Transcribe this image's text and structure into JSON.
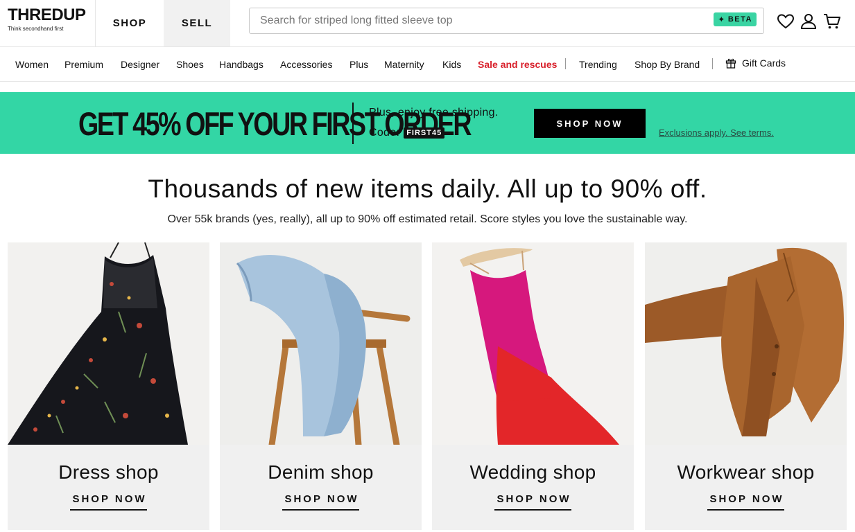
{
  "brand": {
    "name": "THREDUP",
    "tagline": "Think secondhand first"
  },
  "header": {
    "tabs": [
      {
        "label": "SHOP"
      },
      {
        "label": "SELL"
      }
    ],
    "search": {
      "placeholder": "Search for striped long fitted sleeve top",
      "badge": "BETA"
    },
    "icons": [
      "heart-icon",
      "account-icon",
      "cart-icon"
    ]
  },
  "categories": [
    {
      "label": "Women"
    },
    {
      "label": "Premium"
    },
    {
      "label": "Designer"
    },
    {
      "label": "Shoes"
    },
    {
      "label": "Handbags"
    },
    {
      "label": "Accessories"
    },
    {
      "label": "Plus"
    },
    {
      "label": "Maternity"
    },
    {
      "label": "Kids"
    },
    {
      "label": "Sale and rescues"
    },
    {
      "label": "Trending"
    },
    {
      "label": "Shop By Brand"
    },
    {
      "label": "Gift Cards"
    }
  ],
  "promo": {
    "headline": "GET 45% OFF YOUR FIRST ORDER",
    "shipping": "Plus, enjoy free shipping.",
    "code_label": "Code:",
    "code": "FIRST45",
    "button": "SHOP NOW",
    "terms": "Exclusions apply. See terms."
  },
  "hero": {
    "headline": "Thousands of new items daily. All up to 90% off.",
    "subline": "Over 55k brands (yes, really), all up to 90% off estimated retail. Score styles you love the sustainable way."
  },
  "cards": [
    {
      "title": "Dress shop",
      "cta": "SHOP NOW"
    },
    {
      "title": "Denim shop",
      "cta": "SHOP NOW"
    },
    {
      "title": "Wedding shop",
      "cta": "SHOP NOW"
    },
    {
      "title": "Workwear shop",
      "cta": "SHOP NOW"
    }
  ],
  "colors": {
    "promo_bg": "#33d6a5",
    "sale": "#d81f2a",
    "card_bg": "#f0f0f0"
  }
}
